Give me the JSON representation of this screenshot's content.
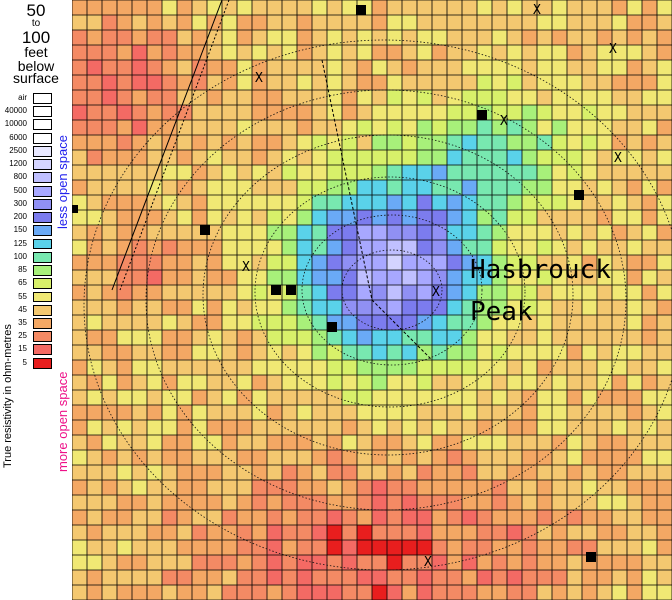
{
  "depth_label": {
    "line1": "50",
    "line2": "to",
    "line3": "100",
    "line4": "feet",
    "line5": "below",
    "line6": "surface"
  },
  "scale": {
    "axis_label": "True resistivity in ohm-metres",
    "less_open": "less open space",
    "more_open": "more open space",
    "labels": [
      "air",
      "40000",
      "10000",
      "6000",
      "2500",
      "1200",
      "800",
      "500",
      "300",
      "200",
      "150",
      "125",
      "100",
      "85",
      "65",
      "55",
      "45",
      "35",
      "25",
      "15",
      "5"
    ],
    "colors": [
      "#ffffff",
      "#ffffff",
      "#ffffff",
      "#ffffff",
      "#e8e8ff",
      "#d4d4ff",
      "#c0c0ff",
      "#a8a8ff",
      "#9090f4",
      "#7c7cee",
      "#6aaaf6",
      "#5ad2ea",
      "#78e8b0",
      "#a8f07a",
      "#d8f06a",
      "#f0e874",
      "#f4c870",
      "#f4a864",
      "#f48a64",
      "#f46a64",
      "#e81e1e"
    ],
    "color_less": "#2222ee",
    "color_more": "#ee1188"
  },
  "map": {
    "labels": {
      "peak_line1": "Hasbrouck",
      "peak_line2": "Peak"
    }
  }
}
